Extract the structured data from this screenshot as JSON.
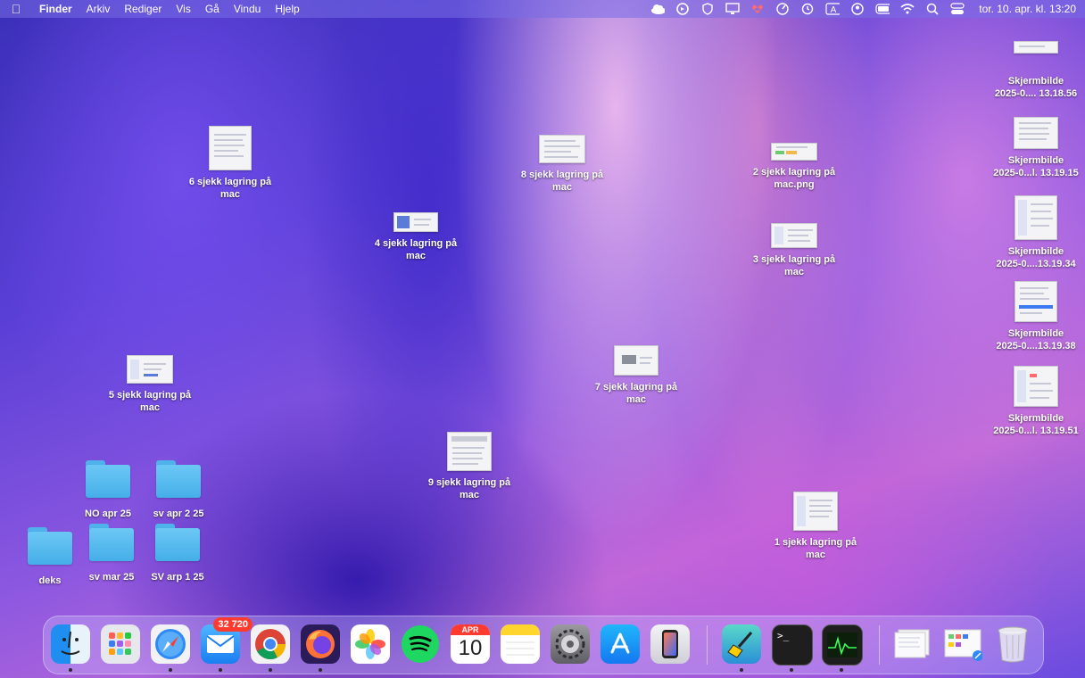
{
  "menubar": {
    "app_name": "Finder",
    "menus": [
      "Arkiv",
      "Rediger",
      "Vis",
      "Gå",
      "Vindu",
      "Hjelp"
    ],
    "clock": "tor. 10. apr. kl. 13:20",
    "status_icons": [
      "icloud-icon",
      "sync-icon",
      "shield-icon",
      "display-icon",
      "dropbox-icon",
      "gauge-icon",
      "clock-history-icon",
      "keyboard-input-icon",
      "user-icon",
      "battery-icon",
      "wifi-icon",
      "spotlight-icon",
      "control-center-icon"
    ]
  },
  "desktop": {
    "files": [
      {
        "name": "6 sjekk lagring på\nmac"
      },
      {
        "name": "8 sjekk lagring på\nmac"
      },
      {
        "name": "2 sjekk lagring på\nmac.png"
      },
      {
        "name": "4 sjekk lagring på\nmac"
      },
      {
        "name": "3 sjekk lagring på\nmac"
      },
      {
        "name": "5 sjekk lagring på\nmac"
      },
      {
        "name": "7 sjekk lagring på\nmac"
      },
      {
        "name": "9 sjekk lagring på\nmac"
      },
      {
        "name": "1 sjekk lagring på\nmac"
      },
      {
        "name": "Skjermbilde\n2025-0.... 13.18.56"
      },
      {
        "name": "Skjermbilde\n2025-0...l. 13.19.15"
      },
      {
        "name": "Skjermbilde\n2025-0....13.19.34"
      },
      {
        "name": "Skjermbilde\n2025-0....13.19.38"
      },
      {
        "name": "Skjermbilde\n2025-0...l. 13.19.51"
      }
    ],
    "folders": [
      {
        "name": "NO apr 25"
      },
      {
        "name": "sv apr 2 25"
      },
      {
        "name": "deks"
      },
      {
        "name": "sv mar 25"
      },
      {
        "name": "SV arp 1 25"
      }
    ]
  },
  "dock": {
    "apps": [
      {
        "name": "Finder",
        "icon": "finder-icon"
      },
      {
        "name": "Launchpad",
        "icon": "launchpad-icon"
      },
      {
        "name": "Safari",
        "icon": "safari-icon"
      },
      {
        "name": "Mail",
        "icon": "mail-icon",
        "badge": "32 720"
      },
      {
        "name": "Chrome",
        "icon": "chrome-icon"
      },
      {
        "name": "Firefox",
        "icon": "firefox-icon"
      },
      {
        "name": "Photos",
        "icon": "photos-icon"
      },
      {
        "name": "Spotify",
        "icon": "spotify-icon"
      },
      {
        "name": "Calendar",
        "icon": "calendar-icon",
        "month": "APR",
        "day": "10"
      },
      {
        "name": "Notes",
        "icon": "notes-icon"
      },
      {
        "name": "System Settings",
        "icon": "settings-icon"
      },
      {
        "name": "App Store",
        "icon": "app-store-icon"
      },
      {
        "name": "iPhone Mirroring",
        "icon": "iphone-icon"
      },
      {
        "name": "CleanMyMac",
        "icon": "broom-icon"
      },
      {
        "name": "Terminal",
        "icon": "terminal-icon"
      },
      {
        "name": "Activity Monitor",
        "icon": "activity-monitor-icon"
      },
      {
        "name": "Recent screenshots stack",
        "icon": "screenshot-stack-icon"
      },
      {
        "name": "Downloads stack",
        "icon": "downloads-stack-icon"
      },
      {
        "name": "Trash",
        "icon": "trash-icon"
      }
    ],
    "terminal_prompt": ">_"
  }
}
